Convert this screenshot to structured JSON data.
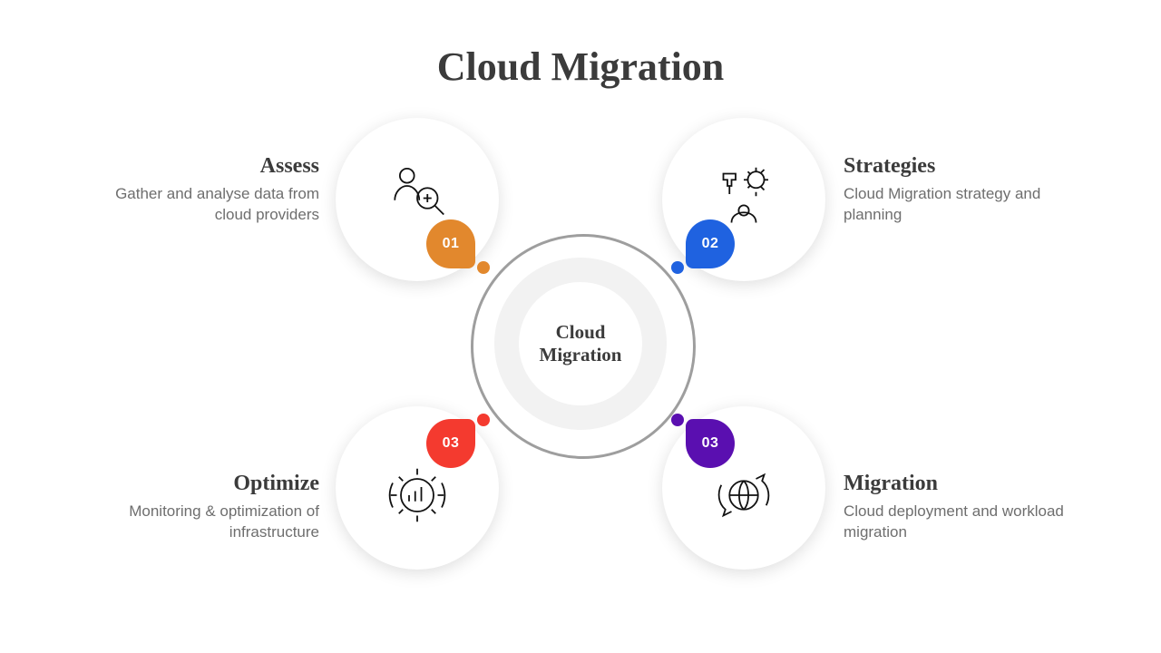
{
  "title": "Cloud Migration",
  "hub": "Cloud\nMigration",
  "nodes": {
    "tl": {
      "num": "01",
      "heading": "Assess",
      "body": "Gather and analyse data from cloud providers",
      "icon": "assess-icon",
      "color": "#e2882d"
    },
    "tr": {
      "num": "02",
      "heading": "Strategies",
      "body": "Cloud Migration strategy and planning",
      "icon": "strategies-icon",
      "color": "#1f62e0"
    },
    "bl": {
      "num": "03",
      "heading": "Optimize",
      "body": "Monitoring & optimization of infrastructure",
      "icon": "optimize-icon",
      "color": "#f43a2f"
    },
    "br": {
      "num": "03",
      "heading": "Migration",
      "body": "Cloud deployment and workload migration",
      "icon": "migration-icon",
      "color": "#5a0fb0"
    }
  }
}
